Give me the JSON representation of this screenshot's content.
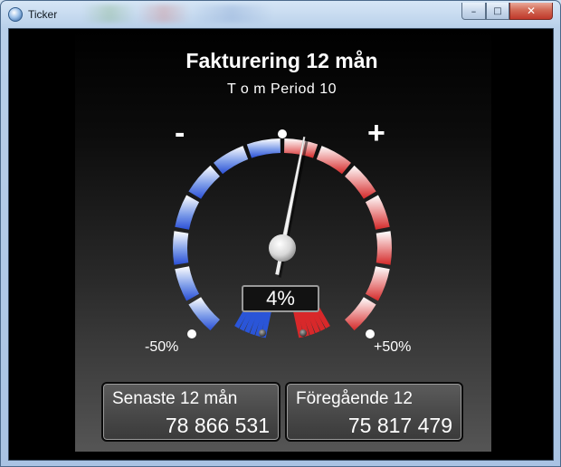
{
  "window": {
    "title": "Ticker",
    "controls": {
      "minimize": "–",
      "maximize": "□",
      "close": "✕"
    }
  },
  "widget": {
    "title": "Fakturering 12 mån",
    "subtitle": "T o m  Period 10",
    "gauge": {
      "minus_label": "-",
      "plus_label": "+",
      "min_label": "-50%",
      "max_label": "+50%",
      "value_text": "4%",
      "value": 4,
      "range": [
        -50,
        50
      ],
      "colors": {
        "negative": "#2a55d8",
        "positive": "#d8282a",
        "neutral": "#ffffff"
      }
    },
    "cards": [
      {
        "label": "Senaste 12 mån",
        "value": "78 866 531"
      },
      {
        "label": "Föregående 12",
        "value": "75 817 479"
      }
    ]
  }
}
